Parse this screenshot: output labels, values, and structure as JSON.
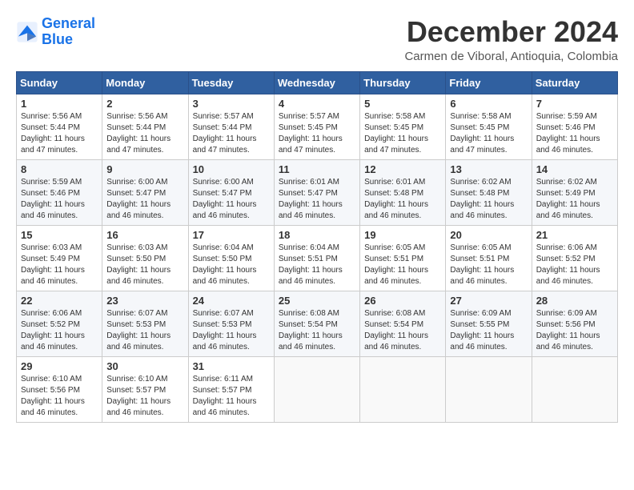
{
  "logo": {
    "line1": "General",
    "line2": "Blue"
  },
  "title": "December 2024",
  "subtitle": "Carmen de Viboral, Antioquia, Colombia",
  "weekdays": [
    "Sunday",
    "Monday",
    "Tuesday",
    "Wednesday",
    "Thursday",
    "Friday",
    "Saturday"
  ],
  "weeks": [
    [
      {
        "day": "1",
        "sunrise": "5:56 AM",
        "sunset": "5:44 PM",
        "daylight": "11 hours and 47 minutes."
      },
      {
        "day": "2",
        "sunrise": "5:56 AM",
        "sunset": "5:44 PM",
        "daylight": "11 hours and 47 minutes."
      },
      {
        "day": "3",
        "sunrise": "5:57 AM",
        "sunset": "5:44 PM",
        "daylight": "11 hours and 47 minutes."
      },
      {
        "day": "4",
        "sunrise": "5:57 AM",
        "sunset": "5:45 PM",
        "daylight": "11 hours and 47 minutes."
      },
      {
        "day": "5",
        "sunrise": "5:58 AM",
        "sunset": "5:45 PM",
        "daylight": "11 hours and 47 minutes."
      },
      {
        "day": "6",
        "sunrise": "5:58 AM",
        "sunset": "5:45 PM",
        "daylight": "11 hours and 47 minutes."
      },
      {
        "day": "7",
        "sunrise": "5:59 AM",
        "sunset": "5:46 PM",
        "daylight": "11 hours and 46 minutes."
      }
    ],
    [
      {
        "day": "8",
        "sunrise": "5:59 AM",
        "sunset": "5:46 PM",
        "daylight": "11 hours and 46 minutes."
      },
      {
        "day": "9",
        "sunrise": "6:00 AM",
        "sunset": "5:47 PM",
        "daylight": "11 hours and 46 minutes."
      },
      {
        "day": "10",
        "sunrise": "6:00 AM",
        "sunset": "5:47 PM",
        "daylight": "11 hours and 46 minutes."
      },
      {
        "day": "11",
        "sunrise": "6:01 AM",
        "sunset": "5:47 PM",
        "daylight": "11 hours and 46 minutes."
      },
      {
        "day": "12",
        "sunrise": "6:01 AM",
        "sunset": "5:48 PM",
        "daylight": "11 hours and 46 minutes."
      },
      {
        "day": "13",
        "sunrise": "6:02 AM",
        "sunset": "5:48 PM",
        "daylight": "11 hours and 46 minutes."
      },
      {
        "day": "14",
        "sunrise": "6:02 AM",
        "sunset": "5:49 PM",
        "daylight": "11 hours and 46 minutes."
      }
    ],
    [
      {
        "day": "15",
        "sunrise": "6:03 AM",
        "sunset": "5:49 PM",
        "daylight": "11 hours and 46 minutes."
      },
      {
        "day": "16",
        "sunrise": "6:03 AM",
        "sunset": "5:50 PM",
        "daylight": "11 hours and 46 minutes."
      },
      {
        "day": "17",
        "sunrise": "6:04 AM",
        "sunset": "5:50 PM",
        "daylight": "11 hours and 46 minutes."
      },
      {
        "day": "18",
        "sunrise": "6:04 AM",
        "sunset": "5:51 PM",
        "daylight": "11 hours and 46 minutes."
      },
      {
        "day": "19",
        "sunrise": "6:05 AM",
        "sunset": "5:51 PM",
        "daylight": "11 hours and 46 minutes."
      },
      {
        "day": "20",
        "sunrise": "6:05 AM",
        "sunset": "5:51 PM",
        "daylight": "11 hours and 46 minutes."
      },
      {
        "day": "21",
        "sunrise": "6:06 AM",
        "sunset": "5:52 PM",
        "daylight": "11 hours and 46 minutes."
      }
    ],
    [
      {
        "day": "22",
        "sunrise": "6:06 AM",
        "sunset": "5:52 PM",
        "daylight": "11 hours and 46 minutes."
      },
      {
        "day": "23",
        "sunrise": "6:07 AM",
        "sunset": "5:53 PM",
        "daylight": "11 hours and 46 minutes."
      },
      {
        "day": "24",
        "sunrise": "6:07 AM",
        "sunset": "5:53 PM",
        "daylight": "11 hours and 46 minutes."
      },
      {
        "day": "25",
        "sunrise": "6:08 AM",
        "sunset": "5:54 PM",
        "daylight": "11 hours and 46 minutes."
      },
      {
        "day": "26",
        "sunrise": "6:08 AM",
        "sunset": "5:54 PM",
        "daylight": "11 hours and 46 minutes."
      },
      {
        "day": "27",
        "sunrise": "6:09 AM",
        "sunset": "5:55 PM",
        "daylight": "11 hours and 46 minutes."
      },
      {
        "day": "28",
        "sunrise": "6:09 AM",
        "sunset": "5:56 PM",
        "daylight": "11 hours and 46 minutes."
      }
    ],
    [
      {
        "day": "29",
        "sunrise": "6:10 AM",
        "sunset": "5:56 PM",
        "daylight": "11 hours and 46 minutes."
      },
      {
        "day": "30",
        "sunrise": "6:10 AM",
        "sunset": "5:57 PM",
        "daylight": "11 hours and 46 minutes."
      },
      {
        "day": "31",
        "sunrise": "6:11 AM",
        "sunset": "5:57 PM",
        "daylight": "11 hours and 46 minutes."
      },
      null,
      null,
      null,
      null
    ]
  ]
}
